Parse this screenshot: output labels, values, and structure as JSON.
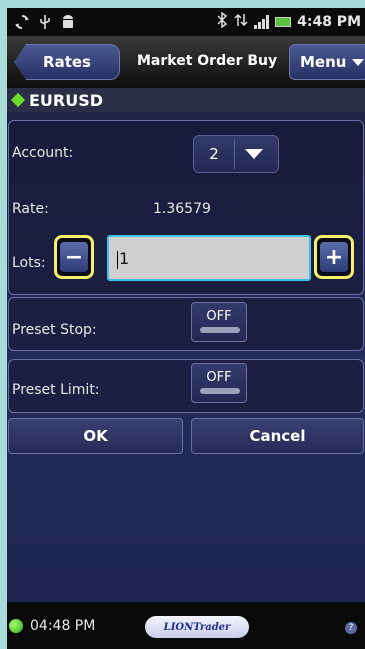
{
  "status_bar": {
    "time": "4:48 PM",
    "icons": [
      "sync-icon",
      "usb-icon",
      "android-debug-icon",
      "bluetooth-icon",
      "data-transfer-icon",
      "signal-icon",
      "battery-icon"
    ]
  },
  "titlebar": {
    "back_label": "Rates",
    "title": "Market Order Buy",
    "menu_label": "Menu"
  },
  "symbol": "EURUSD",
  "form": {
    "account_label": "Account:",
    "account_value": "2",
    "rate_label": "Rate:",
    "rate_value": "1.36579",
    "lots_label": "Lots:",
    "lots_value": "1",
    "minus_label": "−",
    "plus_label": "+",
    "preset_stop_label": "Preset Stop:",
    "preset_stop_value": "OFF",
    "preset_limit_label": "Preset Limit:",
    "preset_limit_value": "OFF"
  },
  "actions": {
    "ok_label": "OK",
    "cancel_label": "Cancel"
  },
  "footer": {
    "time": "04:48 PM",
    "logo_text": "LIONTrader",
    "help_label": "?"
  },
  "colors": {
    "frame": "#a8dcd8",
    "highlight": "#f5f06a",
    "input_border": "#3fc2e6",
    "status_dot": "#2faa1e"
  }
}
